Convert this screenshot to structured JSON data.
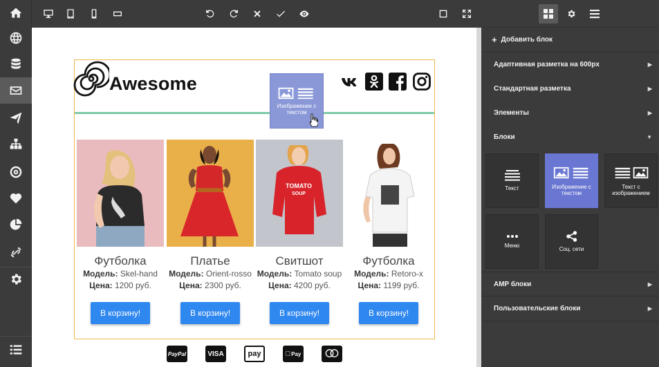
{
  "app": {
    "sidebar_icons": [
      "home-icon",
      "globe-icon",
      "database-icon",
      "mail-icon",
      "paper-plane-icon",
      "sitemap-icon",
      "target-icon",
      "heart-icon",
      "pie-chart-icon",
      "link-icon",
      "gear-icon",
      "list-icon"
    ],
    "active_sidebar": "mail-icon"
  },
  "toolbar": {
    "icons": [
      "desktop-icon",
      "tablet-icon",
      "mobile-icon",
      "mobile-landscape-icon",
      "undo-icon",
      "redo-icon",
      "clear-icon",
      "save-check-icon",
      "preview-eye-icon",
      "square-icon",
      "fullscreen-icon"
    ]
  },
  "email": {
    "logo_text": "Awesome",
    "drag_ghost_label": "Изображение с текстом",
    "products": [
      {
        "name": "Футболка",
        "model_label": "Модель:",
        "model": "Skel-hand",
        "price_label": "Цена:",
        "price": "1200 руб.",
        "button": "В корзину!"
      },
      {
        "name": "Платье",
        "model_label": "Модель:",
        "model": "Orient-rosso",
        "price_label": "Цена:",
        "price": "2300 руб.",
        "button": "В корзину!"
      },
      {
        "name": "Свитшот",
        "model_label": "Модель:",
        "model": "Tomato soup",
        "price_label": "Цена:",
        "price": "4200 руб.",
        "button": "В корзину!"
      },
      {
        "name": "Футболка",
        "model_label": "Модель:",
        "model": "Retoro-x",
        "price_label": "Цена:",
        "price": "1199 руб.",
        "button": "В корзину!"
      }
    ],
    "payments": [
      "PayPal",
      "VISA",
      "pay",
      "Pay",
      "mastercard"
    ]
  },
  "panel": {
    "tabs": [
      "blocks-grid-icon",
      "gear-icon",
      "menu-icon"
    ],
    "add_block": "Добавить блок",
    "sections": [
      {
        "label": "Адаптивная разметка на 600px"
      },
      {
        "label": "Стандартная разметка"
      },
      {
        "label": "Элементы"
      },
      {
        "label": "Блоки"
      },
      {
        "label": "AMP блоки"
      },
      {
        "label": "Пользовательские блоки"
      }
    ],
    "blocks": [
      {
        "label": "Текст"
      },
      {
        "label": "Изображение с текстом"
      },
      {
        "label": "Текст с изображением"
      },
      {
        "label": "Меню"
      },
      {
        "label": "Соц. сети"
      }
    ]
  },
  "colors": {
    "accent": "#2f87f0",
    "block_border": "#f0b84a",
    "divider_green": "#7ecaa6",
    "active_block": "#6a77d2",
    "chrome": "#3b3b3b"
  }
}
